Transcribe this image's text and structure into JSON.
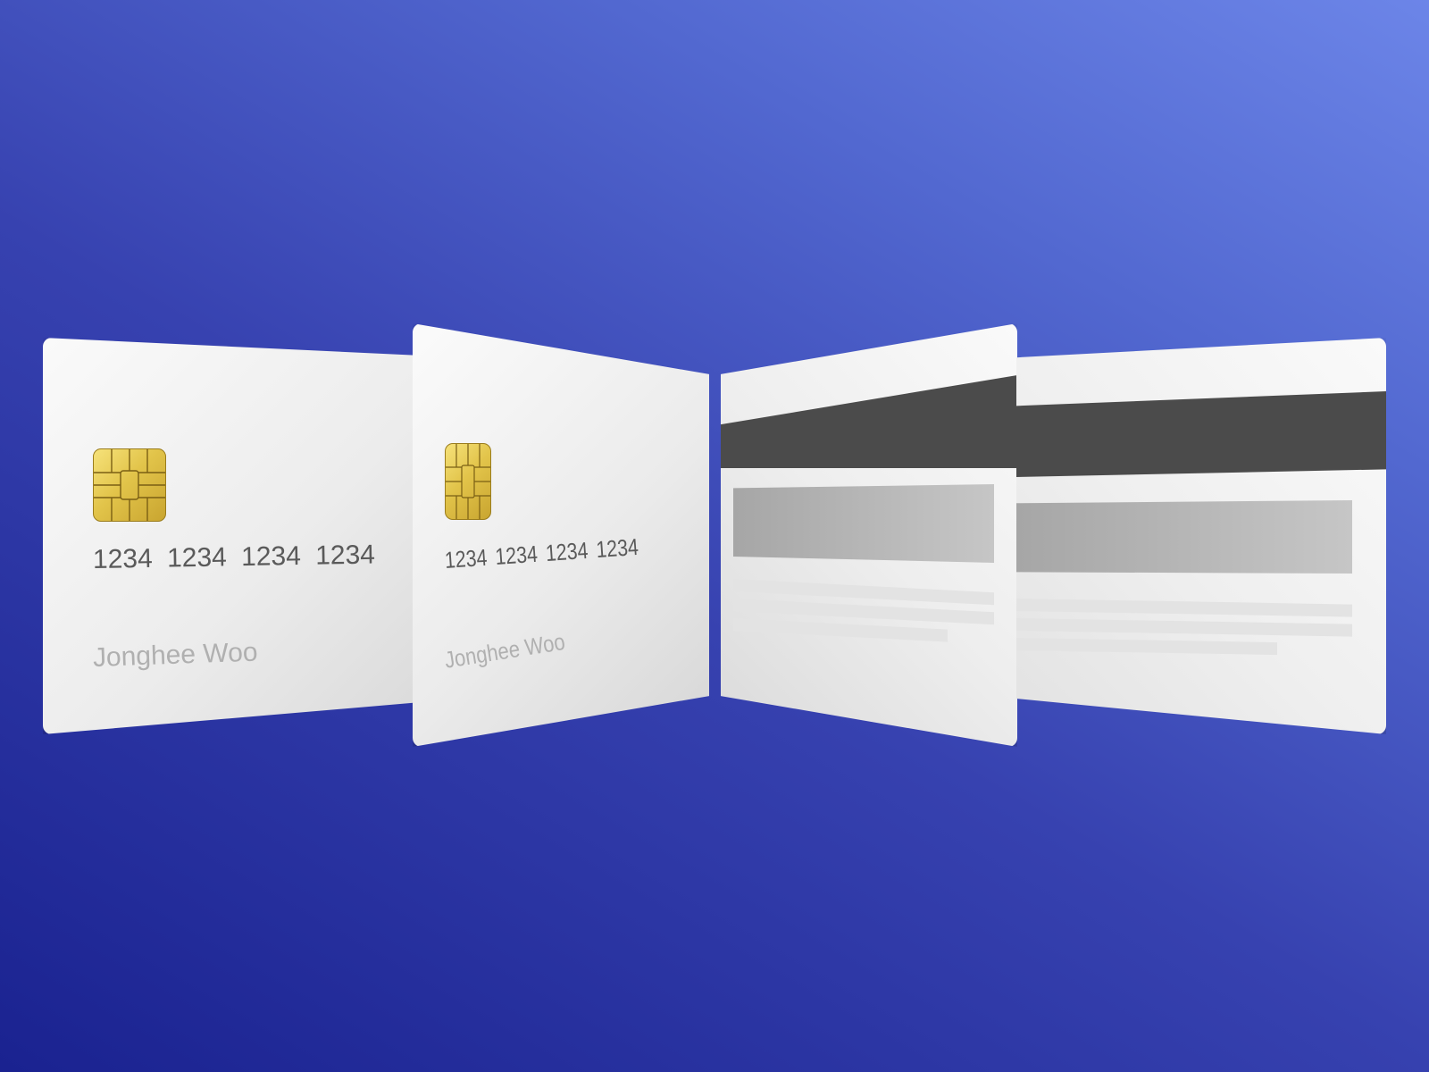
{
  "cards": {
    "front_1": {
      "number": "1234 1234 1234 1234",
      "name": "Jonghee Woo"
    },
    "front_2": {
      "number": "1234 1234 1234 1234",
      "name": "Jonghee Woo"
    }
  },
  "colors": {
    "background_start": "#1a2290",
    "background_end": "#6c85e8",
    "card": "#f2f2f2",
    "chip": "#e2c44a",
    "magnetic_stripe": "#4b4b4b",
    "signature_panel": "#b6b6b6",
    "number_text": "#5a5a5a",
    "name_text": "#b0b0b0"
  },
  "icons": {
    "chip": "emv-chip-icon"
  }
}
